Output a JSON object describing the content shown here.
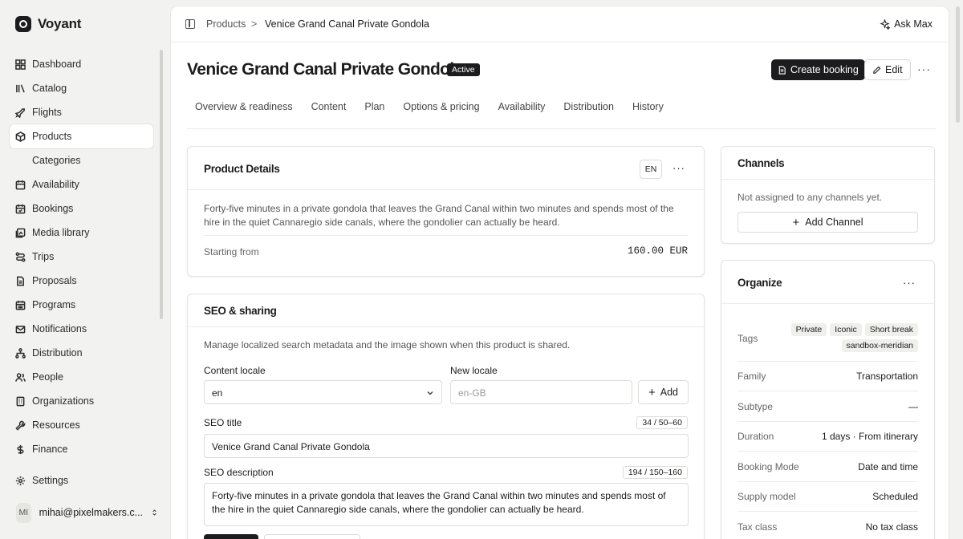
{
  "sidebar": {
    "brand": "Voyant",
    "items": [
      {
        "label": "Dashboard",
        "icon": "dashboard-icon"
      },
      {
        "label": "Catalog",
        "icon": "catalog-icon"
      },
      {
        "label": "Flights",
        "icon": "plane-icon"
      },
      {
        "label": "Products",
        "icon": "box-icon",
        "active": true
      },
      {
        "label": "Categories",
        "sub": true
      },
      {
        "label": "Availability",
        "icon": "calendar-icon"
      },
      {
        "label": "Bookings",
        "icon": "calendar-check-icon"
      },
      {
        "label": "Media library",
        "icon": "image-icon"
      },
      {
        "label": "Trips",
        "icon": "route-icon"
      },
      {
        "label": "Proposals",
        "icon": "document-icon"
      },
      {
        "label": "Programs",
        "icon": "calendar-grid-icon"
      },
      {
        "label": "Notifications",
        "icon": "mail-icon"
      },
      {
        "label": "Distribution",
        "icon": "network-icon"
      },
      {
        "label": "People",
        "icon": "people-icon"
      },
      {
        "label": "Organizations",
        "icon": "building-icon"
      },
      {
        "label": "Resources",
        "icon": "wrench-icon"
      },
      {
        "label": "Finance",
        "icon": "dollar-icon"
      }
    ],
    "settings_label": "Settings",
    "user": {
      "initials": "MI",
      "email": "mihai@pixelmakers.c..."
    }
  },
  "topbar": {
    "breadcrumb_root": "Products",
    "breadcrumb_sep": ">",
    "breadcrumb_current": "Venice Grand Canal Private Gondola",
    "ask_label": "Ask Max"
  },
  "header": {
    "title": "Venice Grand Canal Private Gondola",
    "status": "Active",
    "create_booking": "Create booking",
    "edit": "Edit",
    "more": "···"
  },
  "tabs": [
    "Overview & readiness",
    "Content",
    "Plan",
    "Options & pricing",
    "Availability",
    "Distribution",
    "History"
  ],
  "product_details": {
    "title": "Product Details",
    "locale_badge": "EN",
    "more": "···",
    "description": "Forty-five minutes in a private gondola that leaves the Grand Canal within two minutes and spends most of the hire in the quiet Cannaregio side canals, where the gondolier can actually be heard.",
    "starting_from_label": "Starting from",
    "price": "160.00 EUR"
  },
  "seo": {
    "title": "SEO & sharing",
    "description": "Manage localized search metadata and the image shown when this product is shared.",
    "content_locale_label": "Content locale",
    "content_locale_value": "en",
    "new_locale_label": "New locale",
    "new_locale_placeholder": "en-GB",
    "add_label": "Add",
    "seo_title_label": "SEO title",
    "seo_title_counter": "34 / 50–60",
    "seo_title_value": "Venice Grand Canal Private Gondola",
    "seo_description_label": "SEO description",
    "seo_description_counter": "194 / 150–160",
    "seo_description_value": "Forty-five minutes in a private gondola that leaves the Grand Canal within two minutes and spends most of the hire in the quiet Cannaregio side canals, where the gondolier can actually be heard."
  },
  "channels": {
    "title": "Channels",
    "empty": "Not assigned to any channels yet.",
    "add_label": "Add Channel"
  },
  "organize": {
    "title": "Organize",
    "more": "···",
    "tags_label": "Tags",
    "tags": [
      "Private",
      "Iconic",
      "Short break",
      "sandbox-meridian"
    ],
    "rows": [
      {
        "key": "Family",
        "value": "Transportation"
      },
      {
        "key": "Subtype",
        "value": "—"
      },
      {
        "key": "Duration",
        "value": "1 days · From itinerary"
      },
      {
        "key": "Booking Mode",
        "value": "Date and time"
      },
      {
        "key": "Supply model",
        "value": "Scheduled"
      },
      {
        "key": "Tax class",
        "value": "No tax class"
      }
    ]
  }
}
